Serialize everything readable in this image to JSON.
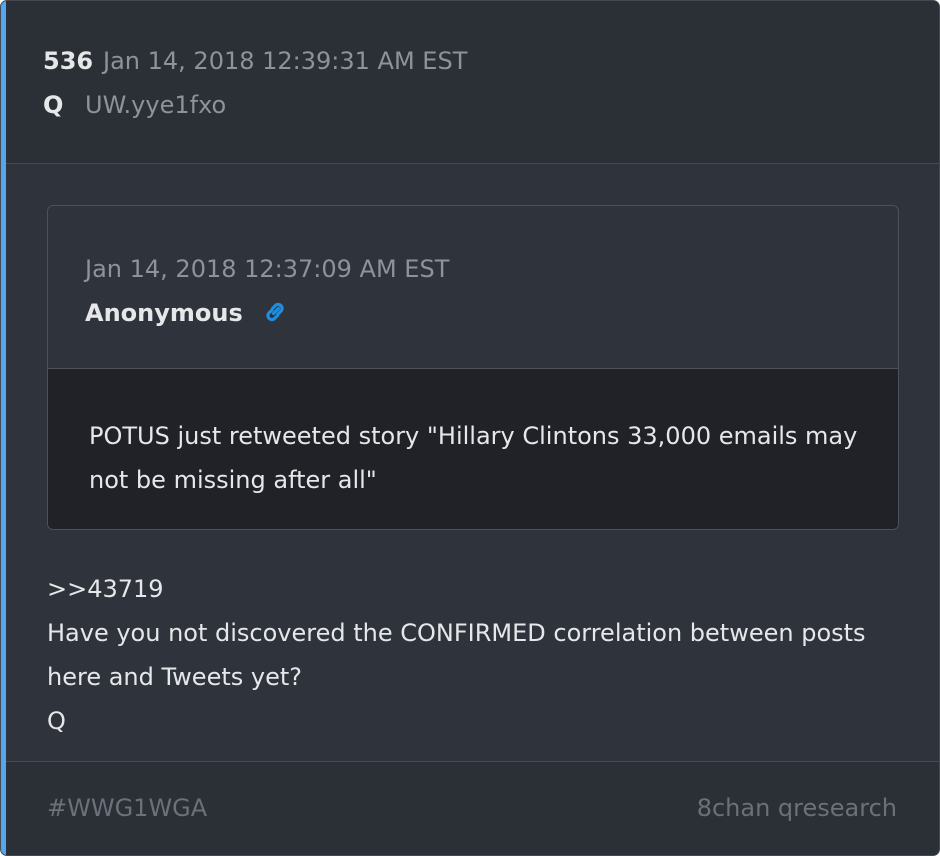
{
  "post": {
    "number": "536",
    "date": "Jan 14, 2018 12:39:31 AM EST",
    "author": "Q",
    "tripcode": "UW.yye1fxo"
  },
  "quoted_post": {
    "date": "Jan 14, 2018 12:37:09 AM EST",
    "author": "Anonymous",
    "link_icon": "link-icon",
    "text": "POTUS just retweeted story \"Hillary Clintons 33,000 emails may not be missing after all\""
  },
  "body": {
    "lines": [
      ">>43719",
      "Have you not discovered the CONFIRMED correlation between posts",
      "here and Tweets yet?",
      "Q"
    ]
  },
  "footer": {
    "hashtag": "#WWG1WGA",
    "source": "8chan qresearch"
  },
  "colors": {
    "accent": "#53a7f0",
    "background": "#2f333b",
    "quote_body_background": "#202227",
    "link_icon": "#1f8ee0"
  }
}
